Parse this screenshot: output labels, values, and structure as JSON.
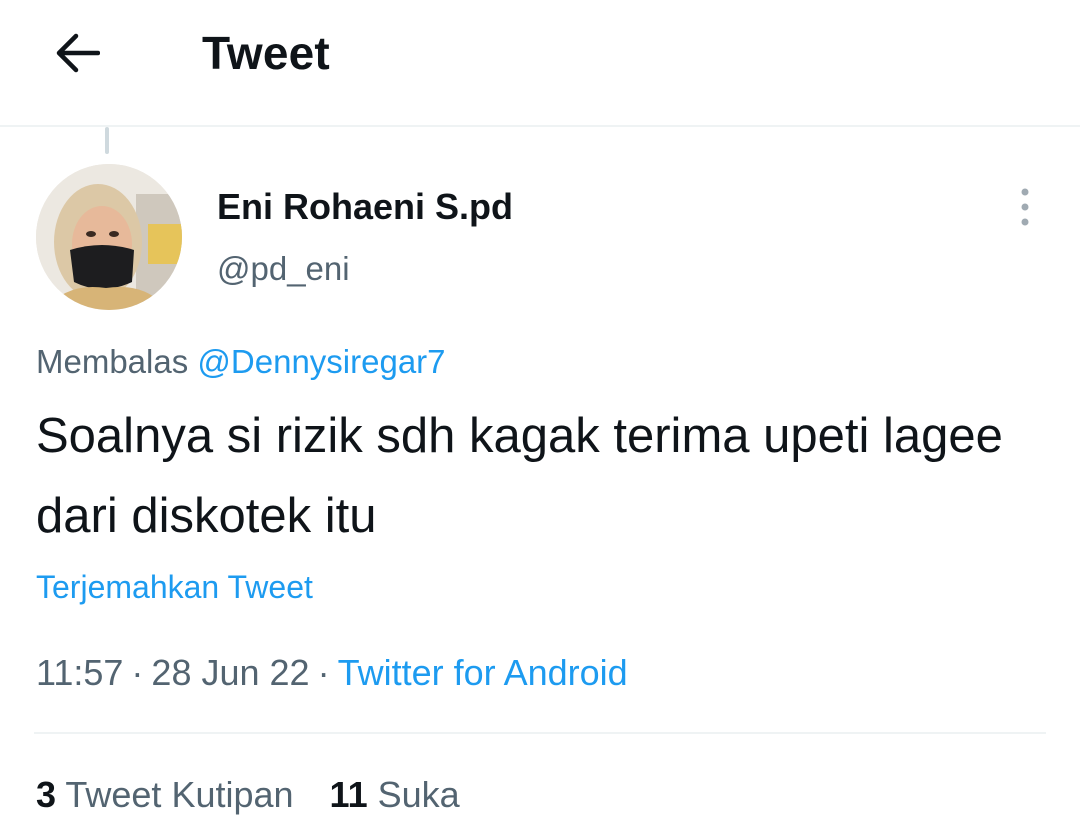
{
  "header": {
    "title": "Tweet",
    "back_icon": "arrow-left-icon"
  },
  "tweet": {
    "author": {
      "name": "Eni Rohaeni S.pd",
      "handle": "@pd_eni",
      "avatar_icon": "avatar-photo"
    },
    "reply_prefix": "Membalas",
    "reply_to": "@Dennysiregar7",
    "text": "Soalnya si rizik sdh kagak terima upeti lagee dari diskotek itu",
    "translate_label": "Terjemahkan Tweet",
    "time": "11:57",
    "date": "28 Jun 22",
    "separator": "·",
    "source": "Twitter for Android",
    "stats": {
      "quotes_count": "3",
      "quotes_label": "Tweet Kutipan",
      "likes_count": "11",
      "likes_label": "Suka"
    }
  },
  "colors": {
    "accent": "#1d9bf0",
    "text_primary": "#0f1419",
    "text_secondary": "#536471",
    "divider": "#eff3f4"
  }
}
